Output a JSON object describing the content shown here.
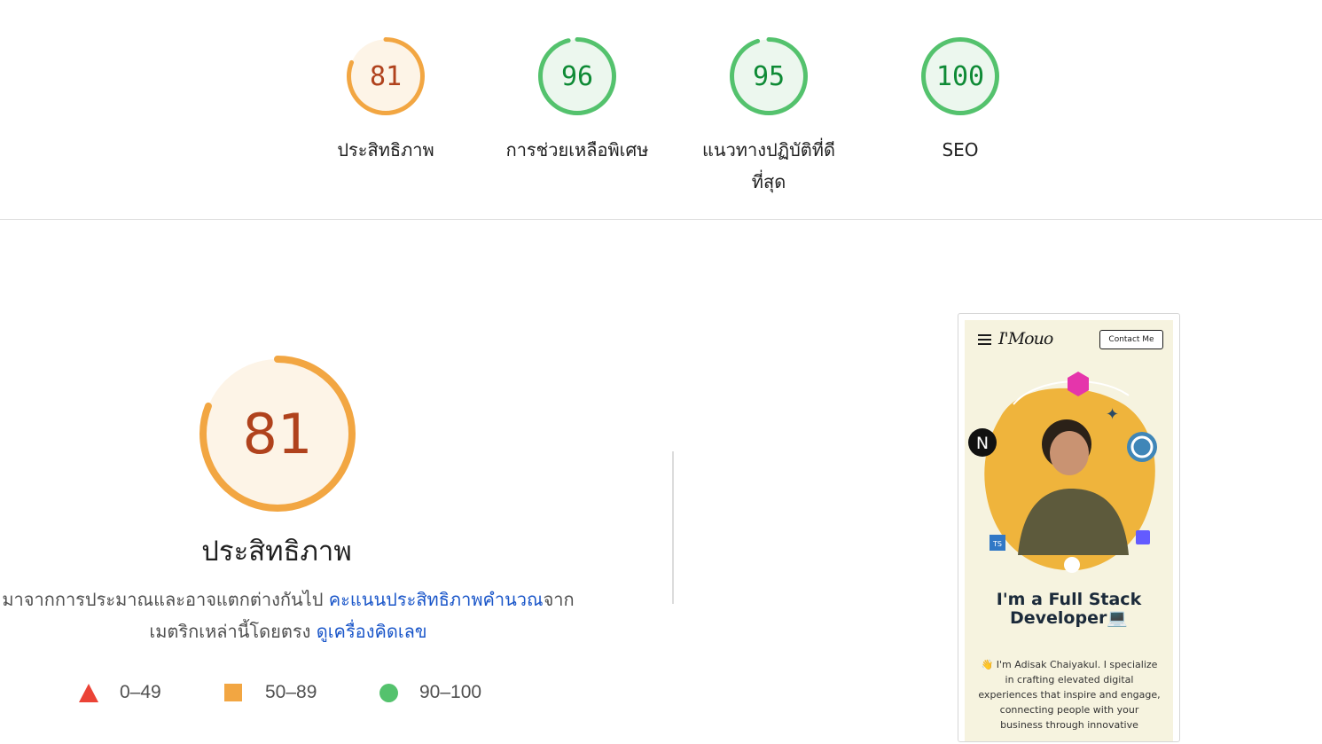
{
  "scores": [
    {
      "value": "81",
      "label": "ประสิทธิภาพ",
      "score": 81,
      "color": "#b0421d",
      "ring": "#f2a642",
      "fill": "#fdf4e7"
    },
    {
      "value": "96",
      "label": "การช่วยเหลือพิเศษ",
      "score": 96,
      "color": "#0e8a35",
      "ring": "#54c26d",
      "fill": "#ecf7ee"
    },
    {
      "value": "95",
      "label": "แนวทางปฏิบัติที่ดีที่สุด",
      "score": 95,
      "color": "#0e8a35",
      "ring": "#54c26d",
      "fill": "#ecf7ee"
    },
    {
      "value": "100",
      "label": "SEO",
      "score": 100,
      "color": "#0e8a35",
      "ring": "#54c26d",
      "fill": "#ecf7ee"
    }
  ],
  "performance": {
    "score_text": "81",
    "score": 81,
    "title": "ประสิทธิภาพ",
    "desc_prefix": "มาจากการประมาณและอาจแตกต่างกันไป ",
    "desc_link1": "คะแนนประสิทธิภาพคำนวณ",
    "desc_mid": "จาก",
    "desc_line2_prefix": "เมตริกเหล่านี้โดยตรง ",
    "desc_link2": "ดูเครื่องคิดเลข"
  },
  "legend": [
    {
      "range": "0–49",
      "shape": "triangle",
      "color": "#eb4336"
    },
    {
      "range": "50–89",
      "shape": "square",
      "color": "#f2a642"
    },
    {
      "range": "90–100",
      "shape": "circle",
      "color": "#54c26d"
    }
  ],
  "screenshot": {
    "logo": "I'Mouo",
    "contact": "Contact Me",
    "headline_1": "I'm a Full Stack",
    "headline_2": "Developer💻",
    "body": "👋 I'm Adisak Chaiyakul. I specialize in crafting elevated digital experiences that inspire and engage, connecting people with your business through innovative"
  }
}
